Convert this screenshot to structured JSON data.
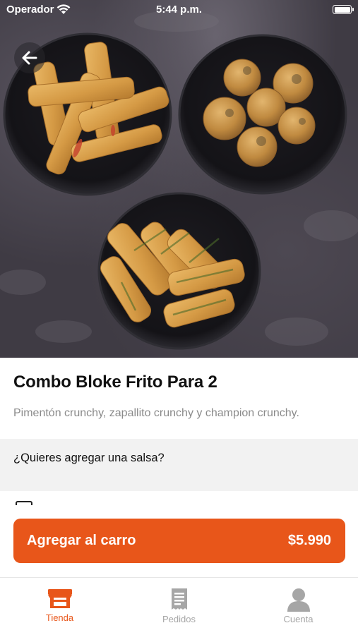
{
  "status_bar": {
    "carrier": "Operador",
    "time": "5:44 p.m."
  },
  "product": {
    "title": "Combo Bloke Frito Para 2",
    "description": "Pimentón crunchy, zapallito crunchy y champion crunchy."
  },
  "sauce_section": {
    "question": "¿Quieres agregar una salsa?"
  },
  "cart": {
    "label": "Agregar al carro",
    "price": "$5.990"
  },
  "tabs": [
    {
      "label": "Tienda",
      "icon": "store-icon",
      "active": true
    },
    {
      "label": "Pedidos",
      "icon": "receipt-icon",
      "active": false
    },
    {
      "label": "Cuenta",
      "icon": "user-icon",
      "active": false
    }
  ],
  "colors": {
    "accent": "#e8561a",
    "section_bg": "#f2f2f2",
    "inactive_tab": "#a6a6a6"
  }
}
